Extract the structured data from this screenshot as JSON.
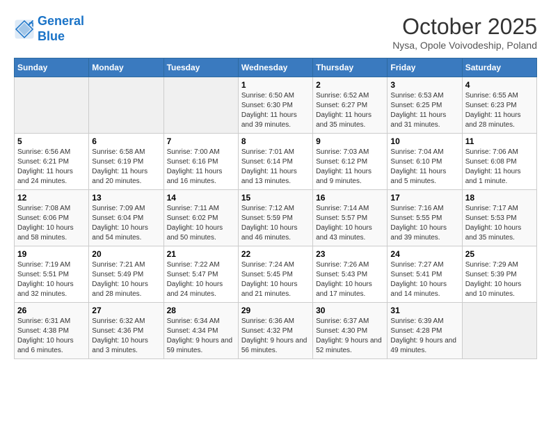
{
  "header": {
    "logo_line1": "General",
    "logo_line2": "Blue",
    "month": "October 2025",
    "location": "Nysa, Opole Voivodeship, Poland"
  },
  "weekdays": [
    "Sunday",
    "Monday",
    "Tuesday",
    "Wednesday",
    "Thursday",
    "Friday",
    "Saturday"
  ],
  "weeks": [
    [
      {
        "day": "",
        "sunrise": "",
        "sunset": "",
        "daylight": ""
      },
      {
        "day": "",
        "sunrise": "",
        "sunset": "",
        "daylight": ""
      },
      {
        "day": "",
        "sunrise": "",
        "sunset": "",
        "daylight": ""
      },
      {
        "day": "1",
        "sunrise": "Sunrise: 6:50 AM",
        "sunset": "Sunset: 6:30 PM",
        "daylight": "Daylight: 11 hours and 39 minutes."
      },
      {
        "day": "2",
        "sunrise": "Sunrise: 6:52 AM",
        "sunset": "Sunset: 6:27 PM",
        "daylight": "Daylight: 11 hours and 35 minutes."
      },
      {
        "day": "3",
        "sunrise": "Sunrise: 6:53 AM",
        "sunset": "Sunset: 6:25 PM",
        "daylight": "Daylight: 11 hours and 31 minutes."
      },
      {
        "day": "4",
        "sunrise": "Sunrise: 6:55 AM",
        "sunset": "Sunset: 6:23 PM",
        "daylight": "Daylight: 11 hours and 28 minutes."
      }
    ],
    [
      {
        "day": "5",
        "sunrise": "Sunrise: 6:56 AM",
        "sunset": "Sunset: 6:21 PM",
        "daylight": "Daylight: 11 hours and 24 minutes."
      },
      {
        "day": "6",
        "sunrise": "Sunrise: 6:58 AM",
        "sunset": "Sunset: 6:19 PM",
        "daylight": "Daylight: 11 hours and 20 minutes."
      },
      {
        "day": "7",
        "sunrise": "Sunrise: 7:00 AM",
        "sunset": "Sunset: 6:16 PM",
        "daylight": "Daylight: 11 hours and 16 minutes."
      },
      {
        "day": "8",
        "sunrise": "Sunrise: 7:01 AM",
        "sunset": "Sunset: 6:14 PM",
        "daylight": "Daylight: 11 hours and 13 minutes."
      },
      {
        "day": "9",
        "sunrise": "Sunrise: 7:03 AM",
        "sunset": "Sunset: 6:12 PM",
        "daylight": "Daylight: 11 hours and 9 minutes."
      },
      {
        "day": "10",
        "sunrise": "Sunrise: 7:04 AM",
        "sunset": "Sunset: 6:10 PM",
        "daylight": "Daylight: 11 hours and 5 minutes."
      },
      {
        "day": "11",
        "sunrise": "Sunrise: 7:06 AM",
        "sunset": "Sunset: 6:08 PM",
        "daylight": "Daylight: 11 hours and 1 minute."
      }
    ],
    [
      {
        "day": "12",
        "sunrise": "Sunrise: 7:08 AM",
        "sunset": "Sunset: 6:06 PM",
        "daylight": "Daylight: 10 hours and 58 minutes."
      },
      {
        "day": "13",
        "sunrise": "Sunrise: 7:09 AM",
        "sunset": "Sunset: 6:04 PM",
        "daylight": "Daylight: 10 hours and 54 minutes."
      },
      {
        "day": "14",
        "sunrise": "Sunrise: 7:11 AM",
        "sunset": "Sunset: 6:02 PM",
        "daylight": "Daylight: 10 hours and 50 minutes."
      },
      {
        "day": "15",
        "sunrise": "Sunrise: 7:12 AM",
        "sunset": "Sunset: 5:59 PM",
        "daylight": "Daylight: 10 hours and 46 minutes."
      },
      {
        "day": "16",
        "sunrise": "Sunrise: 7:14 AM",
        "sunset": "Sunset: 5:57 PM",
        "daylight": "Daylight: 10 hours and 43 minutes."
      },
      {
        "day": "17",
        "sunrise": "Sunrise: 7:16 AM",
        "sunset": "Sunset: 5:55 PM",
        "daylight": "Daylight: 10 hours and 39 minutes."
      },
      {
        "day": "18",
        "sunrise": "Sunrise: 7:17 AM",
        "sunset": "Sunset: 5:53 PM",
        "daylight": "Daylight: 10 hours and 35 minutes."
      }
    ],
    [
      {
        "day": "19",
        "sunrise": "Sunrise: 7:19 AM",
        "sunset": "Sunset: 5:51 PM",
        "daylight": "Daylight: 10 hours and 32 minutes."
      },
      {
        "day": "20",
        "sunrise": "Sunrise: 7:21 AM",
        "sunset": "Sunset: 5:49 PM",
        "daylight": "Daylight: 10 hours and 28 minutes."
      },
      {
        "day": "21",
        "sunrise": "Sunrise: 7:22 AM",
        "sunset": "Sunset: 5:47 PM",
        "daylight": "Daylight: 10 hours and 24 minutes."
      },
      {
        "day": "22",
        "sunrise": "Sunrise: 7:24 AM",
        "sunset": "Sunset: 5:45 PM",
        "daylight": "Daylight: 10 hours and 21 minutes."
      },
      {
        "day": "23",
        "sunrise": "Sunrise: 7:26 AM",
        "sunset": "Sunset: 5:43 PM",
        "daylight": "Daylight: 10 hours and 17 minutes."
      },
      {
        "day": "24",
        "sunrise": "Sunrise: 7:27 AM",
        "sunset": "Sunset: 5:41 PM",
        "daylight": "Daylight: 10 hours and 14 minutes."
      },
      {
        "day": "25",
        "sunrise": "Sunrise: 7:29 AM",
        "sunset": "Sunset: 5:39 PM",
        "daylight": "Daylight: 10 hours and 10 minutes."
      }
    ],
    [
      {
        "day": "26",
        "sunrise": "Sunrise: 6:31 AM",
        "sunset": "Sunset: 4:38 PM",
        "daylight": "Daylight: 10 hours and 6 minutes."
      },
      {
        "day": "27",
        "sunrise": "Sunrise: 6:32 AM",
        "sunset": "Sunset: 4:36 PM",
        "daylight": "Daylight: 10 hours and 3 minutes."
      },
      {
        "day": "28",
        "sunrise": "Sunrise: 6:34 AM",
        "sunset": "Sunset: 4:34 PM",
        "daylight": "Daylight: 9 hours and 59 minutes."
      },
      {
        "day": "29",
        "sunrise": "Sunrise: 6:36 AM",
        "sunset": "Sunset: 4:32 PM",
        "daylight": "Daylight: 9 hours and 56 minutes."
      },
      {
        "day": "30",
        "sunrise": "Sunrise: 6:37 AM",
        "sunset": "Sunset: 4:30 PM",
        "daylight": "Daylight: 9 hours and 52 minutes."
      },
      {
        "day": "31",
        "sunrise": "Sunrise: 6:39 AM",
        "sunset": "Sunset: 4:28 PM",
        "daylight": "Daylight: 9 hours and 49 minutes."
      },
      {
        "day": "",
        "sunrise": "",
        "sunset": "",
        "daylight": ""
      }
    ]
  ]
}
